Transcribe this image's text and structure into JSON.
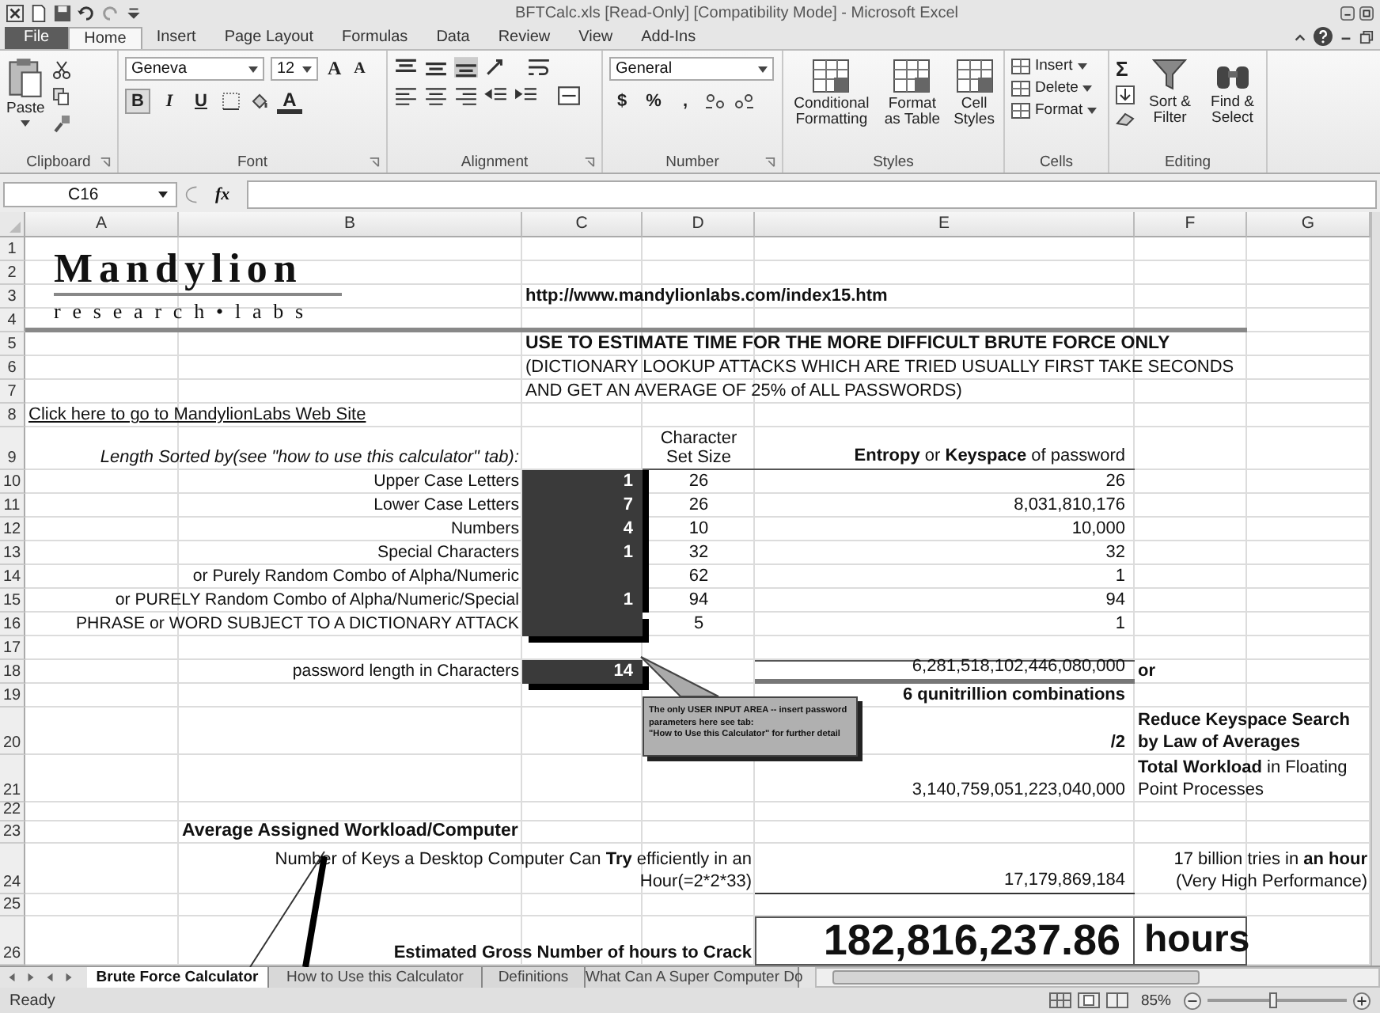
{
  "window": {
    "title": "BFTCalc.xls [Read-Only] [Compatibility Mode] - Microsoft Excel"
  },
  "tabs": [
    {
      "label": "File",
      "selected": false
    },
    {
      "label": "Home",
      "selected": true
    },
    {
      "label": "Insert",
      "selected": false
    },
    {
      "label": "Page Layout",
      "selected": false
    },
    {
      "label": "Formulas",
      "selected": false
    },
    {
      "label": "Data",
      "selected": false
    },
    {
      "label": "Review",
      "selected": false
    },
    {
      "label": "View",
      "selected": false
    },
    {
      "label": "Add-Ins",
      "selected": false
    }
  ],
  "ribbon": {
    "clipboard": {
      "label": "Clipboard",
      "paste": "Paste"
    },
    "font": {
      "label": "Font",
      "name": "Geneva",
      "size": "12",
      "grow": "A",
      "shrink": "A",
      "bold": "B",
      "italic": "I",
      "underline": "U",
      "font_color_button": "A"
    },
    "alignment": {
      "label": "Alignment"
    },
    "number": {
      "label": "Number",
      "format": "General",
      "currency": "$",
      "percent": "%",
      "comma": ","
    },
    "styles": {
      "label": "Styles",
      "buttons": [
        "Conditional Formatting",
        "Format as Table",
        "Cell Styles"
      ]
    },
    "cells": {
      "label": "Cells",
      "buttons": [
        "Insert",
        "Delete",
        "Format"
      ]
    },
    "editing": {
      "label": "Editing",
      "sum": "Σ",
      "buttons": [
        "Sort & Filter",
        "Find & Select"
      ]
    }
  },
  "formula_bar": {
    "name_box": "C16",
    "fx": "fx"
  },
  "sheet": {
    "columns": [
      "A",
      "B",
      "C",
      "D",
      "E",
      "F",
      "G"
    ],
    "rows": [
      {
        "num": "1",
        "a": {
          "kind": "logo",
          "name": "Mandylion",
          "tagline": "research•labs"
        }
      },
      {
        "num": "2"
      },
      {
        "num": "3",
        "c": {
          "kind": "url",
          "text": "http://www.mandylionlabs.com/index15.htm"
        }
      },
      {
        "num": "4"
      },
      {
        "num": "5",
        "c": {
          "kind": "heading",
          "text": "USE TO ESTIMATE TIME FOR THE MORE DIFFICULT BRUTE FORCE ONLY"
        }
      },
      {
        "num": "6",
        "c": {
          "kind": "text",
          "text": "(DICTIONARY LOOKUP ATTACKS WHICH ARE TRIED USUALLY FIRST TAKE SECONDS"
        }
      },
      {
        "num": "7",
        "c": {
          "kind": "text",
          "text": "AND GET AN AVERAGE OF 25% of ALL PASSWORDS)"
        }
      },
      {
        "num": "8",
        "a": {
          "kind": "link",
          "text": "Click here to go to MandylionLabs Web Site"
        }
      },
      {
        "num": "9",
        "b": {
          "kind": "caption",
          "text": "Length Sorted by(see \"how to use this calculator\" tab):"
        },
        "d": {
          "kind": "colhead",
          "lines": [
            "Character",
            "Set Size"
          ]
        },
        "e": {
          "kind": "colhead-main",
          "text": "**Entropy** or **Keyspace** of password"
        }
      },
      {
        "num": "10",
        "b": {
          "kind": "label",
          "text": "Upper  Case Letters"
        },
        "c": {
          "kind": "input",
          "text": "1"
        },
        "d": {
          "kind": "center",
          "text": "26"
        },
        "e": {
          "kind": "number",
          "text": "26"
        }
      },
      {
        "num": "11",
        "b": {
          "kind": "label",
          "text": "Lower Case Letters"
        },
        "c": {
          "kind": "input",
          "text": "7"
        },
        "d": {
          "kind": "center",
          "text": "26"
        },
        "e": {
          "kind": "number",
          "text": "8,031,810,176"
        }
      },
      {
        "num": "12",
        "b": {
          "kind": "label",
          "text": "Numbers"
        },
        "c": {
          "kind": "input",
          "text": "4"
        },
        "d": {
          "kind": "center",
          "text": "10"
        },
        "e": {
          "kind": "number",
          "text": "10,000"
        }
      },
      {
        "num": "13",
        "b": {
          "kind": "label",
          "text": "Special Characters"
        },
        "c": {
          "kind": "input",
          "text": "1"
        },
        "d": {
          "kind": "center",
          "text": "32"
        },
        "e": {
          "kind": "number",
          "text": "32"
        }
      },
      {
        "num": "14",
        "b": {
          "kind": "label",
          "text": "or Purely Random Combo of Alpha/Numeric"
        },
        "c": {
          "kind": "input"
        },
        "d": {
          "kind": "center",
          "text": "62"
        },
        "e": {
          "kind": "number",
          "text": "1"
        }
      },
      {
        "num": "15",
        "b": {
          "kind": "label",
          "text": "or  PURELY Random Combo of Alpha/Numeric/Special"
        },
        "c": {
          "kind": "input",
          "text": "1"
        },
        "d": {
          "kind": "center",
          "text": "94"
        },
        "e": {
          "kind": "number",
          "text": "94"
        }
      },
      {
        "num": "16",
        "b": {
          "kind": "label",
          "text": "PHRASE or WORD SUBJECT TO A DICTIONARY ATTACK"
        },
        "c": {
          "kind": "input"
        },
        "d": {
          "kind": "center",
          "text": "5"
        },
        "e": {
          "kind": "number",
          "text": "1"
        }
      },
      {
        "num": "17"
      },
      {
        "num": "18",
        "b": {
          "kind": "label",
          "text": "password length in Characters"
        },
        "c": {
          "kind": "input",
          "text": "14"
        },
        "e": {
          "kind": "total",
          "text": "6,281,518,102,446,080,000"
        },
        "f": {
          "kind": "or",
          "text": "or"
        }
      },
      {
        "num": "19",
        "e": {
          "kind": "subtotal",
          "text": "6 qunitrillion combinations"
        }
      },
      {
        "num": "20",
        "e": {
          "kind": "factor",
          "text": "/2"
        },
        "f": {
          "kind": "note",
          "lines": [
            "**Reduce Keyspace Search**",
            "**by Law of Averages**"
          ]
        }
      },
      {
        "num": "21",
        "e": {
          "kind": "number",
          "text": "3,140,759,051,223,040,000"
        },
        "f": {
          "kind": "note",
          "lines": [
            "**Total Workload** in Floating",
            "Point Processes"
          ]
        }
      },
      {
        "num": "22"
      },
      {
        "num": "23",
        "b": {
          "kind": "heading",
          "text": "Average Assigned Workload/Computer"
        }
      },
      {
        "num": "24",
        "d": {
          "kind": "note-right",
          "lines": [
            "Number of Keys a Desktop Computer Can **Try** efficiently in an",
            "Hour(=2*2*33)"
          ]
        },
        "e": {
          "kind": "result",
          "text": "17,179,869,184"
        },
        "g": {
          "kind": "note-right",
          "lines": [
            "17 billion tries in **an hour**",
            "(Very High Performance)"
          ]
        }
      },
      {
        "num": "25"
      },
      {
        "num": "26",
        "d": {
          "kind": "label-bold",
          "text": "Estimated Gross Number of hours to Crack"
        },
        "e": {
          "kind": "big",
          "text": "182,816,237.86"
        },
        "f": {
          "kind": "unit",
          "text": "hours"
        }
      }
    ]
  },
  "comment": {
    "lines": [
      "The only USER INPUT AREA -- insert password",
      "parameters here see tab:",
      "\"How to Use this Calculator\" for further detail"
    ]
  },
  "sheet_tabs": [
    {
      "label": "Brute Force Calculator",
      "selected": true
    },
    {
      "label": "How to Use this Calculator",
      "selected": false
    },
    {
      "label": "Definitions",
      "selected": false
    },
    {
      "label": "What Can A Super Computer Do",
      "selected": false
    }
  ],
  "status_bar": {
    "status": "Ready",
    "zoom": "85%",
    "zoom_level": {
      "level": 0.47
    }
  }
}
